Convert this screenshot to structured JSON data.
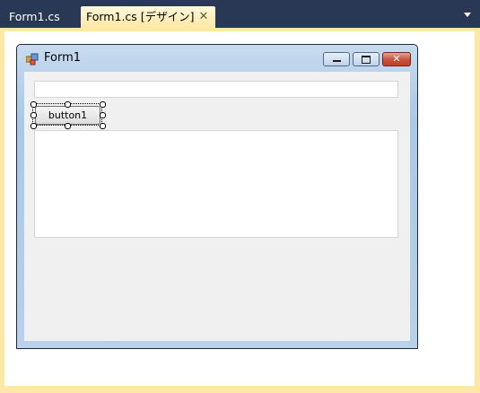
{
  "tabs": {
    "inactive_label": "Form1.cs",
    "active_label": "Form1.cs [デザイン]",
    "close_icon": "close-icon",
    "dropdown_icon": "chevron-down-icon"
  },
  "form": {
    "title": "Form1",
    "icon": "form-icon",
    "caption_buttons": [
      "minimize",
      "maximize",
      "close"
    ],
    "button1_label": "button1"
  },
  "colors": {
    "ide_background": "#293955",
    "active_tab": "#ffe8a6",
    "form_client": "#f0f0f0",
    "close_button": "#c23d28"
  }
}
